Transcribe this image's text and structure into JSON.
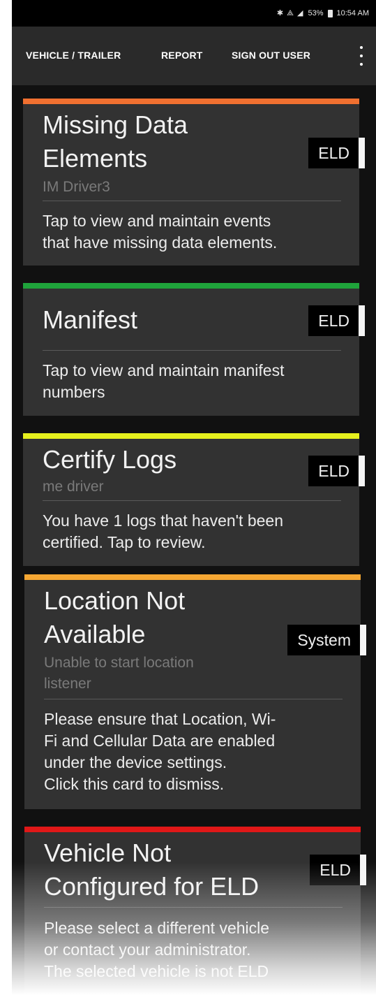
{
  "status_bar": {
    "icons": "✱ ⟁ ◢",
    "battery": "53%",
    "time": "10:54 AM"
  },
  "app_bar": {
    "menu": [
      "VEHICLE / TRAILER",
      "REPORT",
      "SIGN OUT USER"
    ],
    "overflow_icon": "more-vert-icon"
  },
  "cards": [
    {
      "stripe_color": "#f07030",
      "title_lines": [
        "Missing Data",
        "Elements"
      ],
      "subtitle_lines": [
        "IM Driver3"
      ],
      "body_lines": [
        "Tap to view and maintain events",
        "that have missing data elements."
      ],
      "tag": "ELD"
    },
    {
      "stripe_color": "#1fa33b",
      "title_lines": [
        "Manifest"
      ],
      "subtitle_lines": [],
      "body_lines": [
        "Tap to view and maintain manifest",
        "numbers"
      ],
      "tag": "ELD"
    },
    {
      "stripe_color": "#e6f01e",
      "title_lines": [
        "Certify Logs"
      ],
      "subtitle_lines": [
        "me driver"
      ],
      "body_lines": [
        "You have 1 logs that haven't been",
        "certified. Tap to review."
      ],
      "tag": "ELD"
    },
    {
      "stripe_color": "#f5a733",
      "title_lines": [
        "Location Not",
        "Available"
      ],
      "subtitle_lines": [
        "Unable to start location",
        "listener"
      ],
      "body_lines": [
        "Please ensure that Location, Wi-",
        "Fi and Cellular Data are enabled",
        "under the device settings.",
        "Click this card to dismiss."
      ],
      "tag": "System"
    },
    {
      "stripe_color": "#e01818",
      "title_lines": [
        "Vehicle Not",
        "Configured for ELD"
      ],
      "subtitle_lines": [],
      "body_lines": [
        "Please select a different vehicle",
        "or contact your administrator.",
        "The selected vehicle is not ELD"
      ],
      "tag": "ELD"
    }
  ]
}
